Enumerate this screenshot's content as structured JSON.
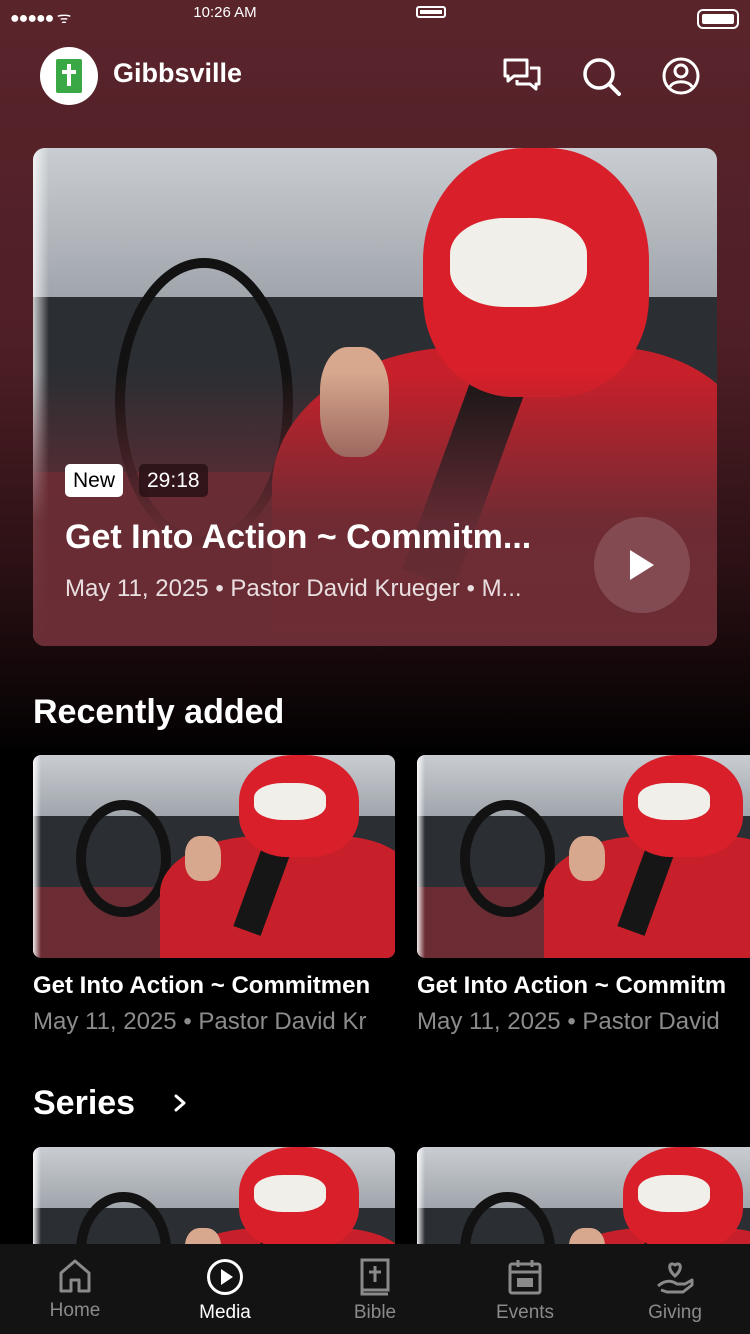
{
  "status_bar": {
    "signal": "●●●●● ᯤ",
    "time": "10:26 AM"
  },
  "header": {
    "title": "Gibbsville",
    "icons": [
      "chat-icon",
      "search-icon",
      "account-icon"
    ]
  },
  "hero": {
    "badge_new": "New",
    "duration": "29:18",
    "title": "Get Into Action ~ Commitm...",
    "meta": "May 11, 2025 • Pastor David Krueger • M..."
  },
  "recently_added": {
    "heading": "Recently added",
    "items": [
      {
        "title": "Get Into Action ~ Commitmen",
        "meta": "May 11, 2025 • Pastor David Kr"
      },
      {
        "title": "Get Into Action ~ Commitm",
        "meta": "May 11, 2025 • Pastor David"
      }
    ]
  },
  "series": {
    "heading": "Series"
  },
  "tabs": [
    {
      "label": "Home",
      "icon": "home-icon"
    },
    {
      "label": "Media",
      "icon": "play-circle-icon",
      "active": true
    },
    {
      "label": "Bible",
      "icon": "bible-icon"
    },
    {
      "label": "Events",
      "icon": "calendar-icon"
    },
    {
      "label": "Giving",
      "icon": "giving-icon"
    }
  ],
  "colors": {
    "accent_bg": "#5a242b",
    "background": "#000000",
    "tabbar": "#131313"
  }
}
